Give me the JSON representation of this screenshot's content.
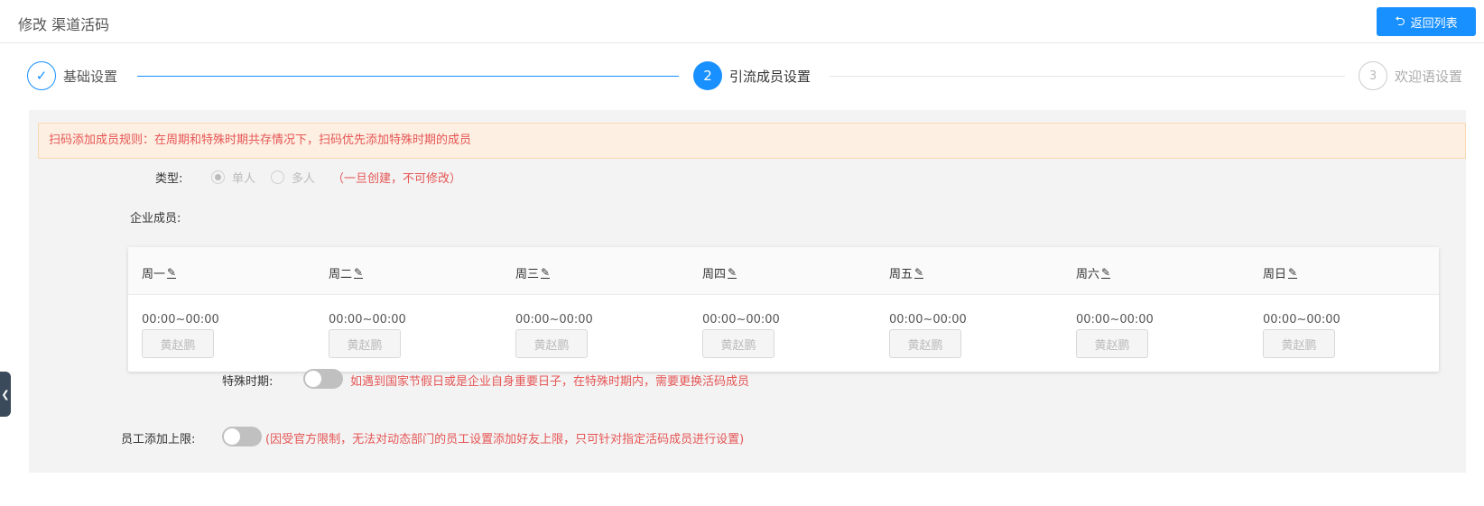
{
  "header": {
    "title": "修改 渠道活码",
    "back_label": "返回列表"
  },
  "steps": [
    {
      "index": "✓",
      "title": "基础设置",
      "status": "finished"
    },
    {
      "index": "2",
      "title": "引流成员设置",
      "status": "active"
    },
    {
      "index": "3",
      "title": "欢迎语设置",
      "status": "waiting"
    }
  ],
  "alert": "扫码添加成员规则：在周期和特殊时期共存情况下，扫码优先添加特殊时期的成员",
  "form": {
    "type_label": "类型:",
    "type_options": [
      "单人",
      "多人"
    ],
    "type_selected": "单人",
    "type_note": "（一旦创建，不可修改）",
    "members_label": "企业成员:",
    "special_label": "特殊时期:",
    "special_note": "如遇到国家节假日或是企业自身重要日子，在特殊时期内，需要更换活码成员",
    "limit_label": "员工添加上限:",
    "limit_note": "(因受官方限制，无法对动态部门的员工设置添加好友上限，只可针对指定活码成员进行设置)"
  },
  "schedule": [
    {
      "day": "周一",
      "time": "00:00~00:00",
      "member": "黄赵鹏"
    },
    {
      "day": "周二",
      "time": "00:00~00:00",
      "member": "黄赵鹏"
    },
    {
      "day": "周三",
      "time": "00:00~00:00",
      "member": "黄赵鹏"
    },
    {
      "day": "周四",
      "time": "00:00~00:00",
      "member": "黄赵鹏"
    },
    {
      "day": "周五",
      "time": "00:00~00:00",
      "member": "黄赵鹏"
    },
    {
      "day": "周六",
      "time": "00:00~00:00",
      "member": "黄赵鹏"
    },
    {
      "day": "周日",
      "time": "00:00~00:00",
      "member": "黄赵鹏"
    }
  ],
  "colors": {
    "primary": "#1890ff",
    "warning_text": "#e65555",
    "alert_bg": "#fdf0e2"
  }
}
